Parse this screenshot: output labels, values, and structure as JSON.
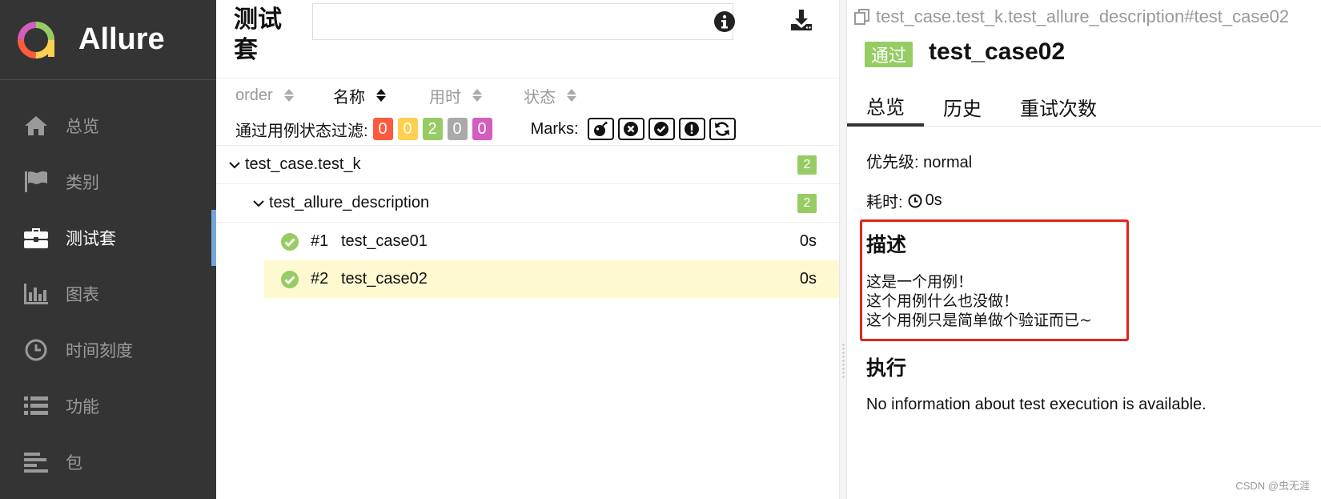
{
  "app": {
    "name": "Allure"
  },
  "sidebar": {
    "items": [
      {
        "label": "总览",
        "icon": "home-icon"
      },
      {
        "label": "类别",
        "icon": "flag-icon"
      },
      {
        "label": "测试套",
        "icon": "briefcase-icon",
        "active": true
      },
      {
        "label": "图表",
        "icon": "bar-chart-icon"
      },
      {
        "label": "时间刻度",
        "icon": "clock-icon"
      },
      {
        "label": "功能",
        "icon": "list-icon"
      },
      {
        "label": "包",
        "icon": "align-left-icon"
      }
    ]
  },
  "suites": {
    "title": "测试套",
    "search": {
      "value": "",
      "placeholder": ""
    },
    "sort": [
      {
        "label": "order"
      },
      {
        "label": "名称",
        "active": true
      },
      {
        "label": "用时"
      },
      {
        "label": "状态"
      }
    ],
    "filter": {
      "label": "通过用例状态过滤:",
      "badges": [
        {
          "value": "0",
          "color": "#fd5a3e"
        },
        {
          "value": "0",
          "color": "#ffd050"
        },
        {
          "value": "2",
          "color": "#97cc64"
        },
        {
          "value": "0",
          "color": "#aaaaaa"
        },
        {
          "value": "0",
          "color": "#d35ebe"
        }
      ],
      "marks_label": "Marks:",
      "marks": [
        "bomb-icon",
        "times-circle-icon",
        "check-circle-icon",
        "exclamation-circle-icon",
        "refresh-icon"
      ]
    },
    "tree": {
      "group": {
        "name": "test_case.test_k",
        "count": "2"
      },
      "subgroup": {
        "name": "test_allure_description",
        "count": "2"
      },
      "cases": [
        {
          "num": "#1",
          "name": "test_case01",
          "duration": "0s"
        },
        {
          "num": "#2",
          "name": "test_case02",
          "duration": "0s",
          "selected": true
        }
      ]
    }
  },
  "detail": {
    "path": "test_case.test_k.test_allure_description#test_case02",
    "status": "通过",
    "title": "test_case02",
    "tabs": [
      "总览",
      "历史",
      "重试次数"
    ],
    "priority": "优先级: normal",
    "duration_label": "耗时:",
    "duration_value": "0s",
    "description_title": "描述",
    "description_lines": [
      "这是一个用例！",
      "这个用例什么也没做！",
      "这个用例只是简单做个验证而已~"
    ],
    "execution_title": "执行",
    "execution_text": "No information about test execution is available."
  },
  "watermark": "CSDN @虫无涯",
  "colors": {
    "sidebar_bg": "#343434",
    "passed": "#97cc64",
    "highlight": "#fff9d2",
    "annotation": "#e3231a"
  }
}
